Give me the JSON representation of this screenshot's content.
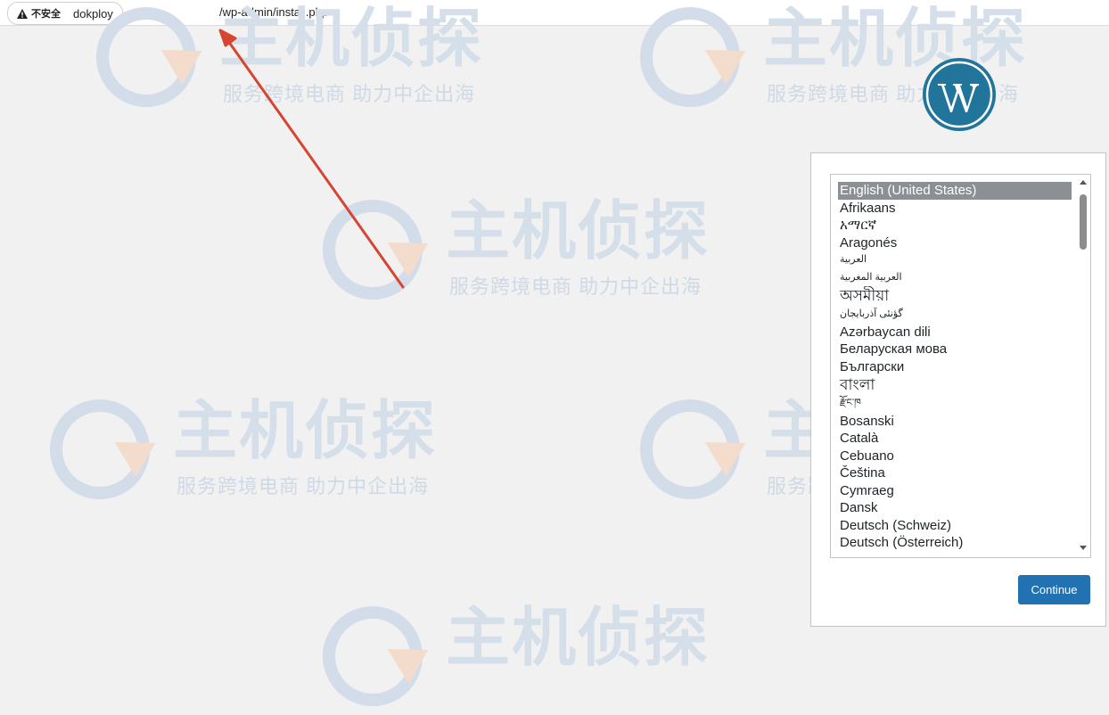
{
  "address_bar": {
    "security_label": "不安全",
    "host": "dokploy",
    "path": "/wp-admin/install.php"
  },
  "watermark": {
    "main_text": "主机侦探",
    "slogan": "服务跨境电商 助力中企出海"
  },
  "icons": {
    "warning": "warning-triangle-icon",
    "logo": "wordpress-logo",
    "scroll_up": "scroll-up-arrow-icon",
    "scroll_down": "scroll-down-arrow-icon"
  },
  "colors": {
    "page_bg": "#f1f1f1",
    "button_bg": "#2271b1",
    "selected_bg": "#8c8f94",
    "arrow": "#d64531",
    "wp_blue": "#21759b"
  },
  "language_select": {
    "selected": "English (United States)",
    "options": [
      "English (United States)",
      "Afrikaans",
      "አማርኛ",
      "Aragonés",
      "العربية",
      "العربية المغربية",
      "অসমীয়া",
      "گؤنئی آذربایجان",
      "Azərbaycan dili",
      "Беларуская мова",
      "Български",
      "বাংলা",
      "རྫོང་ཁ",
      "Bosanski",
      "Català",
      "Cebuano",
      "Čeština",
      "Cymraeg",
      "Dansk",
      "Deutsch (Schweiz)",
      "Deutsch (Österreich)"
    ]
  },
  "continue_label": "Continue"
}
